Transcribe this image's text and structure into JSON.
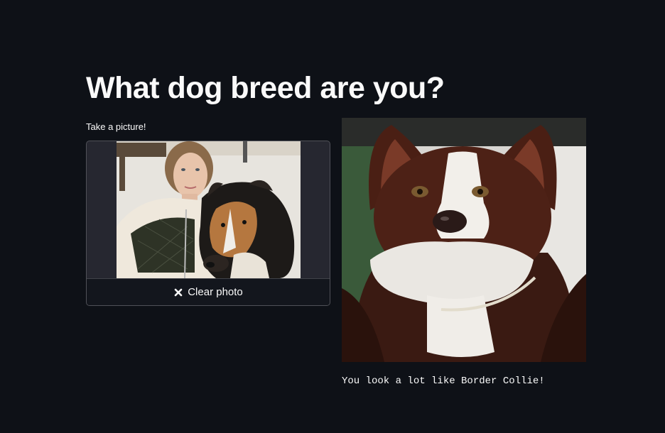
{
  "page": {
    "title": "What dog breed are you?"
  },
  "camera": {
    "label": "Take a picture!",
    "clear_button_label": "Clear photo",
    "clear_icon": "close-icon"
  },
  "result": {
    "text": "You look a lot like Border Collie!"
  },
  "colors": {
    "background": "#0e1117",
    "widget_background": "#262730",
    "text": "#fafafa"
  }
}
